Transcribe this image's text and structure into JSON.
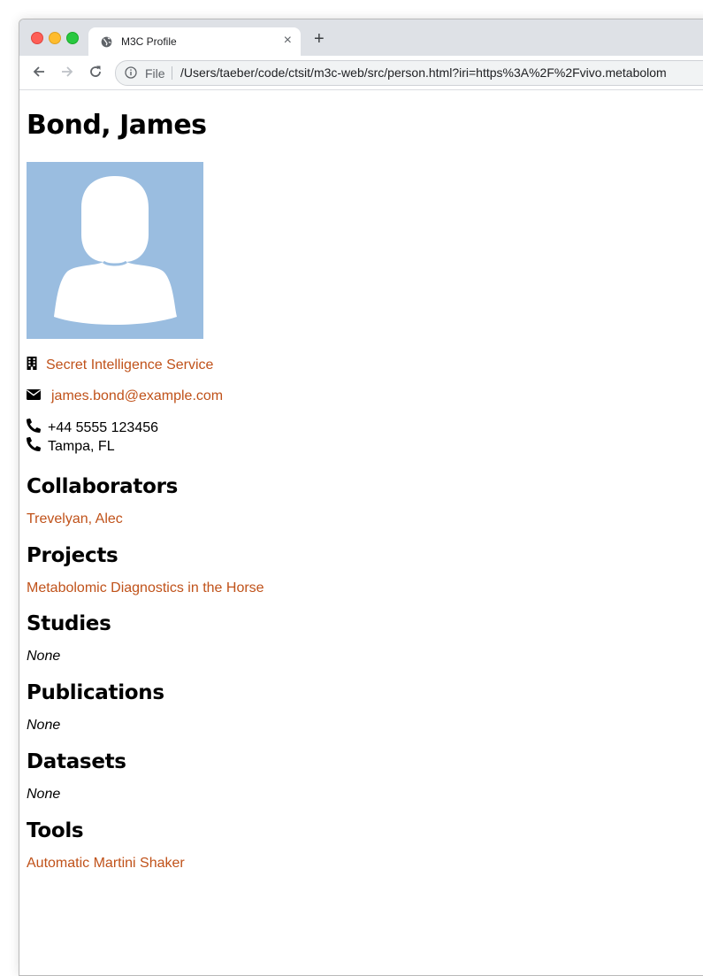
{
  "browser": {
    "tab_title": "M3C Profile",
    "tab_close": "×",
    "new_tab": "+",
    "omnibox_scheme": "File",
    "url": "/Users/taeber/code/ctsit/m3c-web/src/person.html?iri=https%3A%2F%2Fvivo.metabolom"
  },
  "person": {
    "name": "Bond, James",
    "organization": "Secret Intelligence Service",
    "email": "james.bond@example.com",
    "phone": "+44 5555 123456",
    "location": "Tampa, FL"
  },
  "sections": {
    "collaborators": {
      "title": "Collaborators",
      "items": [
        "Trevelyan, Alec"
      ]
    },
    "projects": {
      "title": "Projects",
      "items": [
        "Metabolomic Diagnostics in the Horse"
      ]
    },
    "studies": {
      "title": "Studies",
      "empty": "None"
    },
    "publications": {
      "title": "Publications",
      "empty": "None"
    },
    "datasets": {
      "title": "Datasets",
      "empty": "None"
    },
    "tools": {
      "title": "Tools",
      "items": [
        "Automatic Martini Shaker"
      ]
    }
  },
  "colors": {
    "link": "#c0521a",
    "avatar_bg": "#9abde0"
  }
}
